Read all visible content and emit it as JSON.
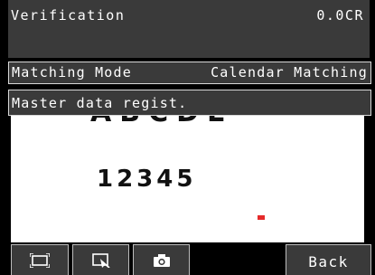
{
  "header": {
    "title": "Verification",
    "value": "0.0CR"
  },
  "mode": {
    "label": "Matching Mode",
    "value": "Calendar Matching"
  },
  "menu": {
    "item": "Master data regist."
  },
  "image": {
    "line1": "ABCDE",
    "line2": "12345"
  },
  "toolbar": {
    "area_icon": "frame-select-icon",
    "zoom_icon": "zoom-select-icon",
    "capture_icon": "camera-icon",
    "back_label": "Back"
  },
  "colors": {
    "panel": "#3a3a3a",
    "background": "#000000",
    "image": "#ffffff",
    "marker": "#e52a2a"
  }
}
